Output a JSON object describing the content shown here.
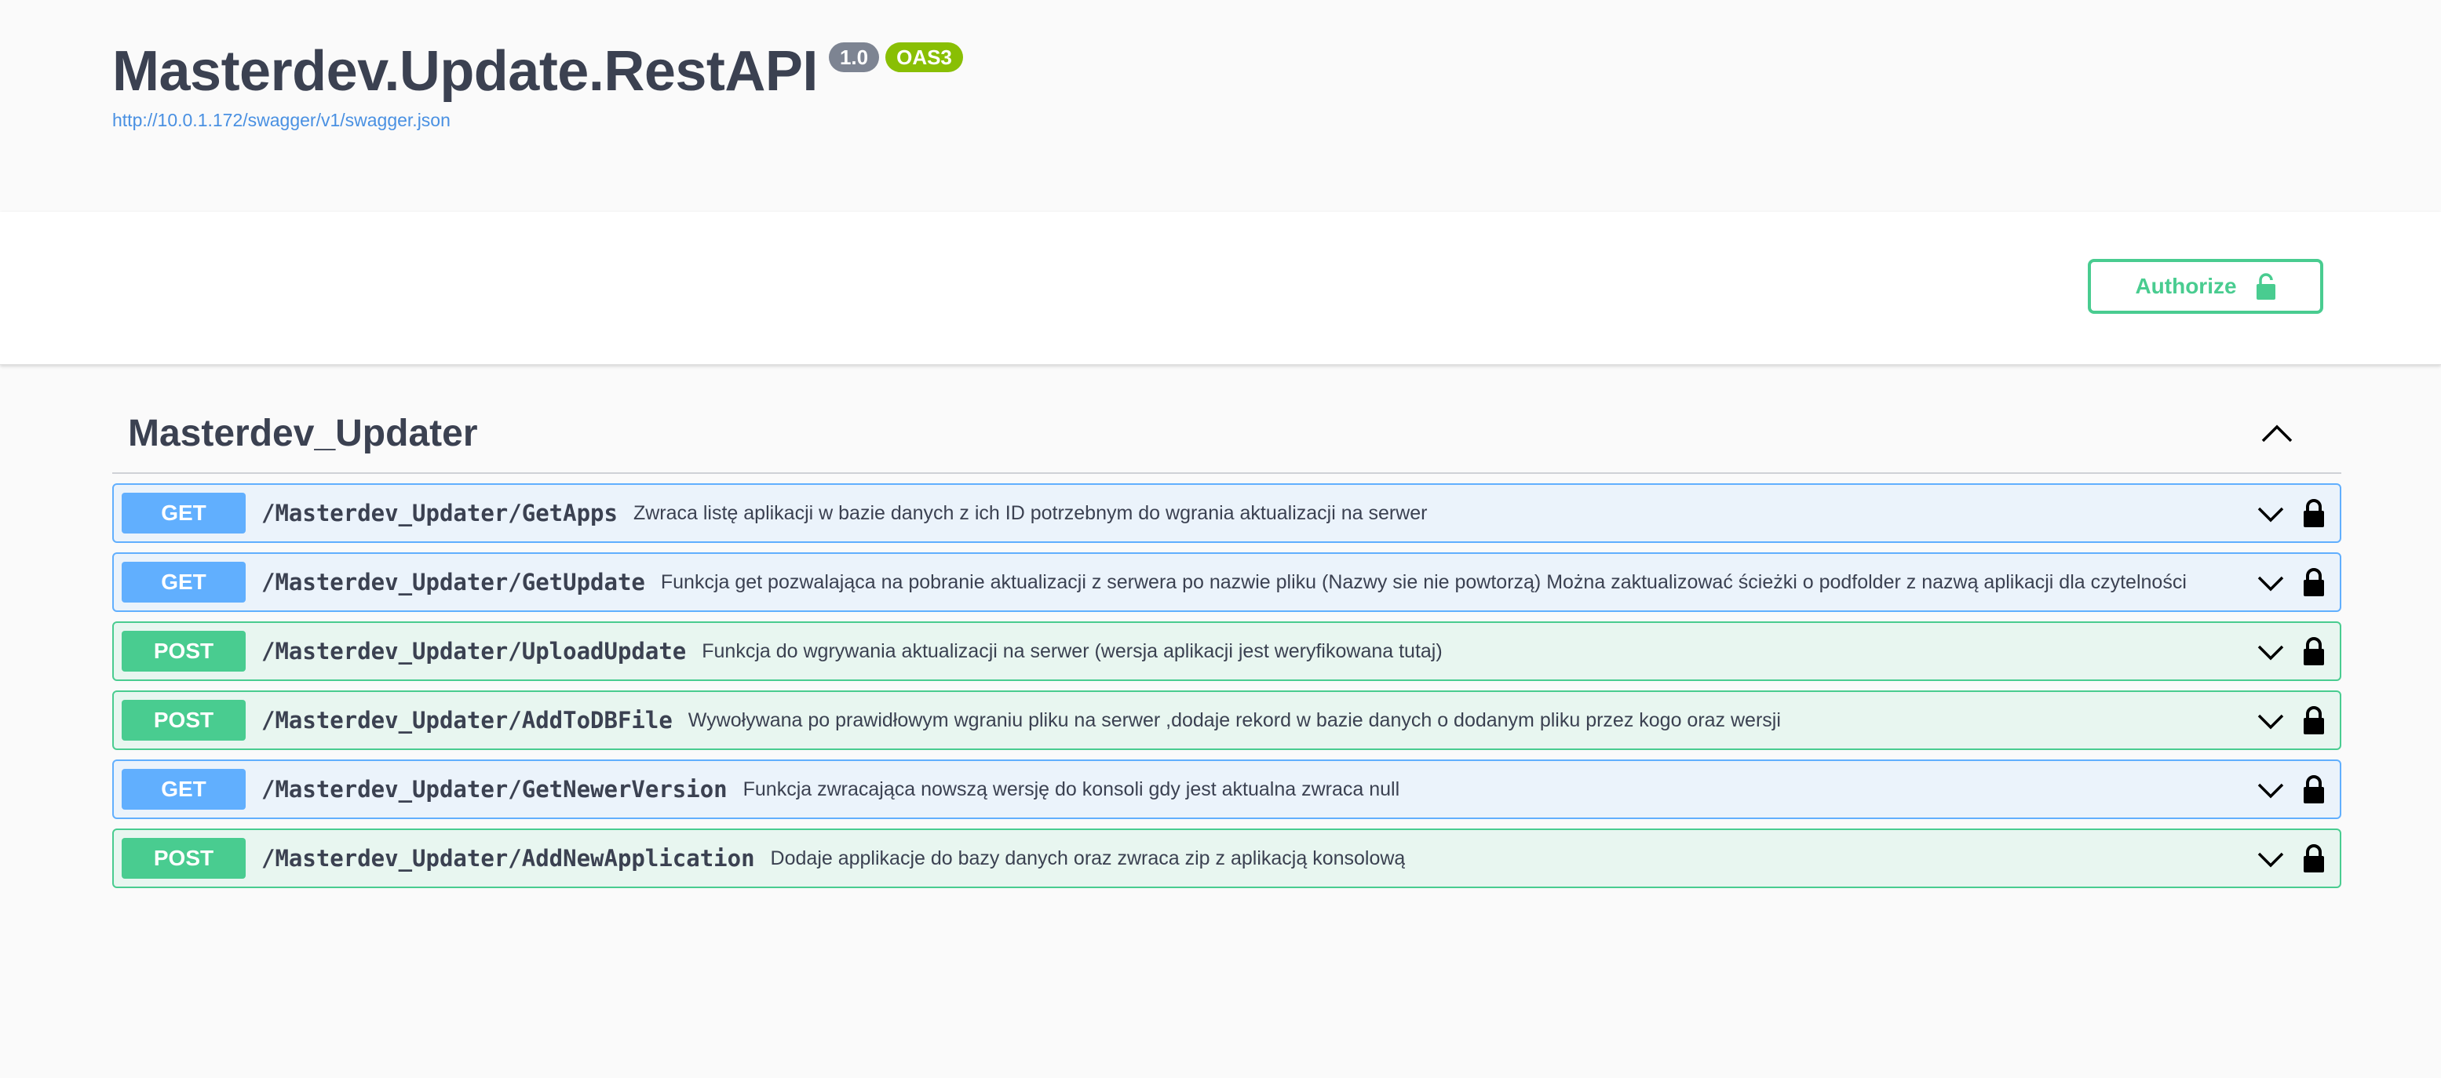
{
  "info": {
    "title": "Masterdev.Update.RestAPI",
    "version_badge": "1.0",
    "oas_badge": "OAS3",
    "spec_url": "http://10.0.1.172/swagger/v1/swagger.json"
  },
  "scheme_bar": {
    "authorize_label": "Authorize"
  },
  "tag": {
    "name": "Masterdev_Updater",
    "operations": [
      {
        "method": "GET",
        "path": "/Masterdev_Updater/GetApps",
        "summary": "Zwraca listę aplikacji w bazie danych z ich ID potrzebnym do wgrania aktualizacji na serwer"
      },
      {
        "method": "GET",
        "path": "/Masterdev_Updater/GetUpdate",
        "summary": "Funkcja get pozwalająca na pobranie aktualizacji z serwera po nazwie pliku (Nazwy sie nie powtorzą) Można zaktualizować ścieżki o podfolder z nazwą aplikacji dla czytelności"
      },
      {
        "method": "POST",
        "path": "/Masterdev_Updater/UploadUpdate",
        "summary": "Funkcja do wgrywania aktualizacji na serwer (wersja aplikacji jest weryfikowana tutaj)"
      },
      {
        "method": "POST",
        "path": "/Masterdev_Updater/AddToDBFile",
        "summary": "Wywoływana po prawidłowym wgraniu pliku na serwer ,dodaje rekord w bazie danych o dodanym pliku przez kogo oraz wersji"
      },
      {
        "method": "GET",
        "path": "/Masterdev_Updater/GetNewerVersion",
        "summary": "Funkcja zwracająca nowszą wersję do konsoli gdy jest aktualna zwraca null"
      },
      {
        "method": "POST",
        "path": "/Masterdev_Updater/AddNewApplication",
        "summary": "Dodaje applikacje do bazy danych oraz zwraca zip z aplikacją konsolową"
      }
    ]
  },
  "colors": {
    "get": "#61affe",
    "post": "#49cc90",
    "title": "#3b4151",
    "link": "#4990e2"
  },
  "icons": {
    "collapse": "chevron-up-icon",
    "expand": "chevron-down-icon",
    "lock": "lock-icon"
  }
}
